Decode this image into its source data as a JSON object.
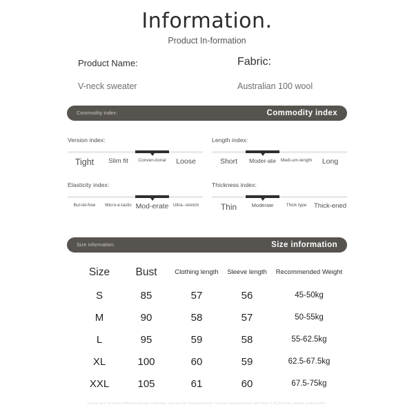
{
  "header": {
    "title": "Information.",
    "subtitle": "Product In-formation"
  },
  "product": {
    "name_label": "Product Name:",
    "name_value": "V-neck sweater",
    "fabric_label": "Fabric:",
    "fabric_value": "Australian 100 wool"
  },
  "banners": {
    "commodity": {
      "small": "Commodity index:",
      "big": "Commodity index"
    },
    "size": {
      "small": "Size information:",
      "big": "Size information"
    }
  },
  "colors": {
    "banner_bg": "#57534f",
    "track": "#eceaea",
    "active": "#2e2e2e",
    "page_bg": "#ffffff"
  },
  "meters": [
    {
      "id": "version",
      "title": "Version index:",
      "active_index": 2,
      "options": [
        {
          "label": "Tight",
          "size": 12.5
        },
        {
          "label": "Slim fit",
          "size": 9.5
        },
        {
          "label": "Conven-tional",
          "size": 6.5
        },
        {
          "label": "Loose",
          "size": 10.5
        }
      ]
    },
    {
      "id": "length",
      "title": "Length index:",
      "active_index": 1,
      "options": [
        {
          "label": "Short",
          "size": 10.5
        },
        {
          "label": "Moder-ate",
          "size": 8.5
        },
        {
          "label": "Medi-um-length",
          "size": 6.5
        },
        {
          "label": "Long",
          "size": 10.5
        }
      ]
    },
    {
      "id": "elasticity",
      "title": "Elasticity index:",
      "active_index": 2,
      "options": [
        {
          "label": "Bul-let-free",
          "size": 6.5
        },
        {
          "label": "Micro-e-lastic",
          "size": 6.5
        },
        {
          "label": "Mod-erate",
          "size": 10.5
        },
        {
          "label": "Ultra--stretch",
          "size": 6.5
        }
      ]
    },
    {
      "id": "thickness",
      "title": "Thickness index:",
      "active_index": 1,
      "options": [
        {
          "label": "Thin",
          "size": 12
        },
        {
          "label": "Moderate",
          "size": 7.5
        },
        {
          "label": "Thick type",
          "size": 6.5
        },
        {
          "label": "Thick-ened",
          "size": 9.5
        }
      ]
    }
  ],
  "size_table": {
    "headers": [
      {
        "text": "Size",
        "style": "big"
      },
      {
        "text": "Bust",
        "style": "big"
      },
      {
        "text": "Clothing length",
        "style": "small"
      },
      {
        "text": "Sleeve length",
        "style": "small"
      },
      {
        "text": "Recommended Weight",
        "style": "small"
      }
    ],
    "rows": [
      {
        "size": "S",
        "bust": "85",
        "clothing_length": "57",
        "sleeve_length": "56",
        "weight": "45-50kg"
      },
      {
        "size": "M",
        "bust": "90",
        "clothing_length": "58",
        "sleeve_length": "57",
        "weight": "50-55kg"
      },
      {
        "size": "L",
        "bust": "95",
        "clothing_length": "59",
        "sleeve_length": "58",
        "weight": "55-62.5kg"
      },
      {
        "size": "XL",
        "bust": "100",
        "clothing_length": "60",
        "sleeve_length": "59",
        "weight": "62.5-67.5kg"
      },
      {
        "size": "XXL",
        "bust": "105",
        "clothing_length": "61",
        "sleeve_length": "60",
        "weight": "67.5-75kg"
      }
    ]
  },
  "footer": {
    "note": "Every item of dress different design materials, we use tile measurement, manual measurement will have 2-4CM error, please understand."
  }
}
